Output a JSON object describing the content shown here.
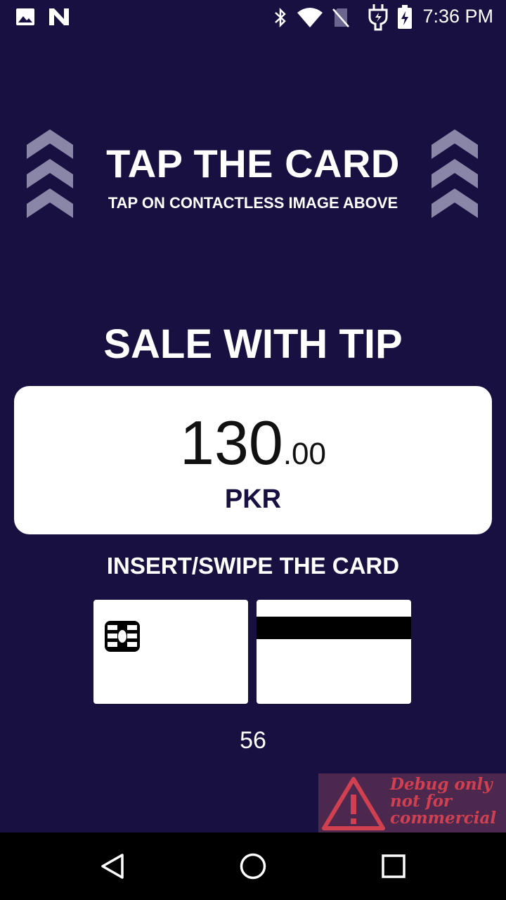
{
  "status_bar": {
    "time": "7:36 PM",
    "left_icons": [
      "image-icon",
      "n-logo-icon"
    ],
    "right_icons": [
      "bluetooth-icon",
      "wifi-icon",
      "no-sim-icon",
      "charging-plug-icon",
      "battery-charging-icon"
    ]
  },
  "tap_section": {
    "title": "TAP THE CARD",
    "subtitle": "TAP ON CONTACTLESS IMAGE ABOVE"
  },
  "transaction": {
    "type": "SALE WITH TIP",
    "amount_integer": "130",
    "amount_decimal": ".00",
    "currency": "PKR"
  },
  "insert_section": {
    "label": "INSERT/SWIPE THE CARD"
  },
  "timer": "56",
  "debug_badge": {
    "line1": "Debug only",
    "line2": "not for",
    "line3": "commercial"
  },
  "nav_bar": {
    "buttons": [
      "back-icon",
      "home-icon",
      "recents-icon"
    ]
  },
  "colors": {
    "background": "#181040",
    "card_surface": "#ffffff",
    "currency_text": "#181040",
    "chevron": "#8a86a8",
    "debug_red": "#d04050"
  }
}
